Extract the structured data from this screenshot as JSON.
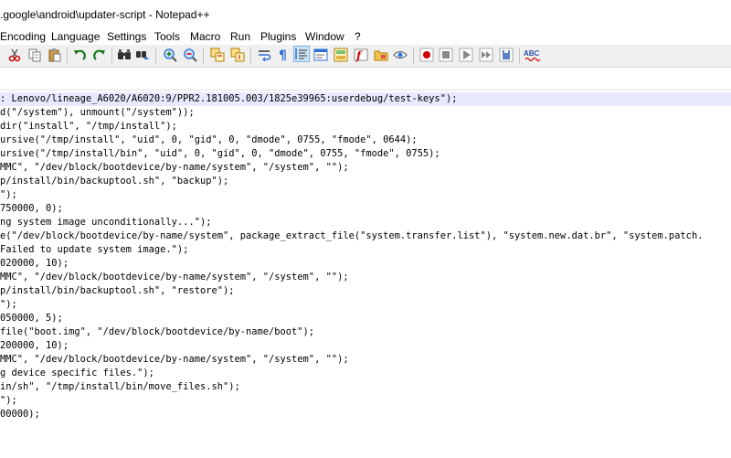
{
  "window": {
    "title": ".google\\android\\updater-script - Notepad++"
  },
  "menubar": {
    "items": [
      "Encoding",
      "Language",
      "Settings",
      "Tools",
      "Macro",
      "Run",
      "Plugins",
      "Window",
      "?"
    ]
  },
  "toolbar": {
    "icons": [
      "cut-icon",
      "copy-icon",
      "paste-icon",
      "undo-icon",
      "redo-icon",
      "find-icon",
      "replace-icon",
      "zoom-in-icon",
      "zoom-out-icon",
      "sync-vertical-icon",
      "sync-horizontal-icon",
      "word-wrap-icon",
      "show-all-chars-icon",
      "indent-guide-icon",
      "udl-icon",
      "doc-map-icon",
      "function-list-icon",
      "folder-workspace-icon",
      "monitoring-icon",
      "record-macro-icon",
      "stop-record-icon",
      "play-macro-icon",
      "play-multiple-icon",
      "save-macro-icon",
      "spell-check-icon"
    ]
  },
  "editor": {
    "current_line": 0,
    "lines": [
      ": Lenovo/lineage_A6020/A6020:9/PPR2.181005.003/1825e39965:userdebug/test-keys\");",
      "d(\"/system\"), unmount(\"/system\"));",
      "dir(\"install\", \"/tmp/install\");",
      "ursive(\"/tmp/install\", \"uid\", 0, \"gid\", 0, \"dmode\", 0755, \"fmode\", 0644);",
      "ursive(\"/tmp/install/bin\", \"uid\", 0, \"gid\", 0, \"dmode\", 0755, \"fmode\", 0755);",
      "MMC\", \"/dev/block/bootdevice/by-name/system\", \"/system\", \"\");",
      "p/install/bin/backuptool.sh\", \"backup\");",
      "\");",
      "750000, 0);",
      "ng system image unconditionally...\");",
      "e(\"/dev/block/bootdevice/by-name/system\", package_extract_file(\"system.transfer.list\"), \"system.new.dat.br\", \"system.patch.",
      "Failed to update system image.\");",
      "020000, 10);",
      "MMC\", \"/dev/block/bootdevice/by-name/system\", \"/system\", \"\");",
      "p/install/bin/backuptool.sh\", \"restore\");",
      "\");",
      "050000, 5);",
      "file(\"boot.img\", \"/dev/block/bootdevice/by-name/boot\");",
      "200000, 10);",
      "MMC\", \"/dev/block/bootdevice/by-name/system\", \"/system\", \"\");",
      "g device specific files.\");",
      "in/sh\", \"/tmp/install/bin/move_files.sh\");",
      "\");",
      "00000);"
    ]
  }
}
